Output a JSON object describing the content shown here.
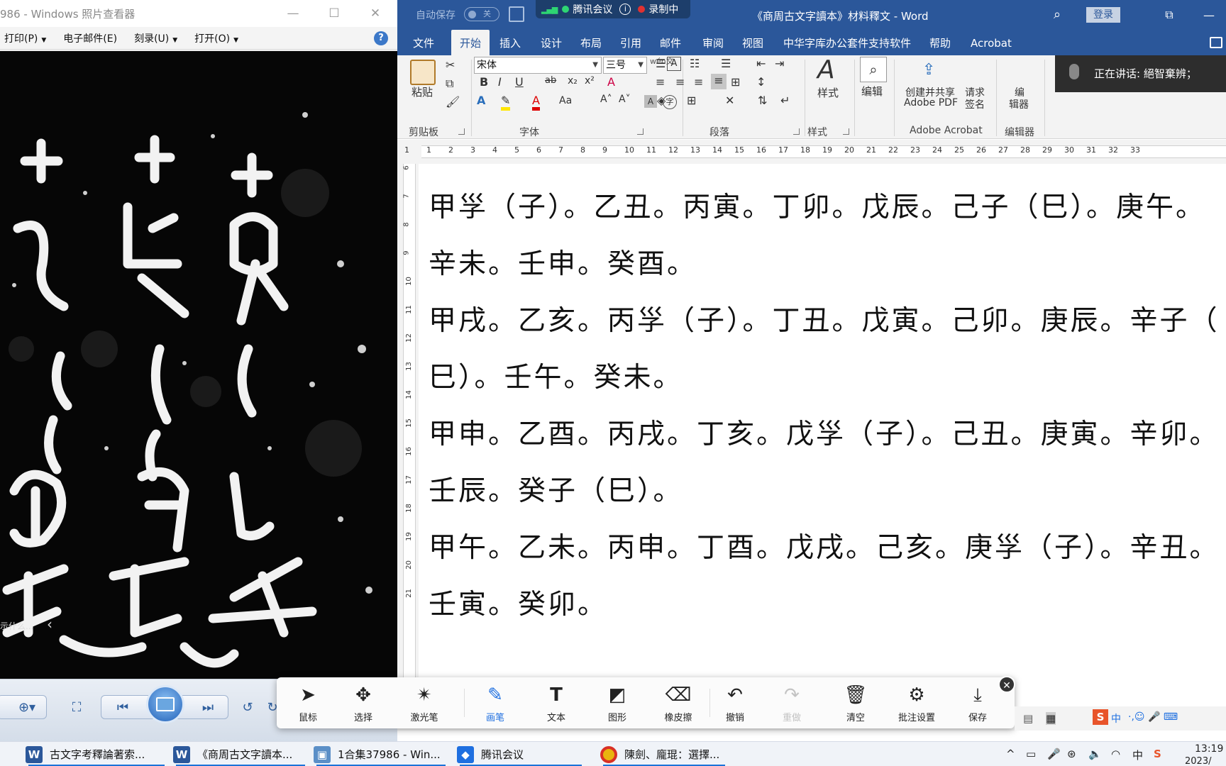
{
  "viewer": {
    "title": "986 - Windows 照片查看器",
    "menu": [
      "打印(P)",
      "电子邮件(E)",
      "刻录(U)",
      "打开(O)"
    ],
    "side_hint": "示什么..."
  },
  "word": {
    "autosave_label": "自动保存",
    "autosave_state": "关",
    "title": "《商周古文字讀本》材料釋文 - Word",
    "login_label": "登录",
    "tabs": [
      "文件",
      "开始",
      "插入",
      "设计",
      "布局",
      "引用",
      "邮件",
      "审阅",
      "视图",
      "中华字库办公套件支持软件",
      "帮助",
      "Acrobat"
    ],
    "ribbon": {
      "paste": "粘贴",
      "font_name": "宋体",
      "font_size": "三号",
      "phonetic": "wén文",
      "styles": "样式",
      "editing": "编辑",
      "create_pdf_1": "创建并共享",
      "create_pdf_2": "Adobe PDF",
      "request_sign_1": "请求",
      "request_sign_2": "签名",
      "editor_1": "编",
      "editor_2": "辑器",
      "groups": [
        "剪贴板",
        "字体",
        "段落",
        "样式",
        "Adobe Acrobat",
        "编辑器"
      ]
    },
    "ruler_h": [
      "1",
      "1",
      "2",
      "3",
      "4",
      "5",
      "6",
      "7",
      "8",
      "9",
      "10",
      "11",
      "12",
      "13",
      "14",
      "15",
      "16",
      "17",
      "18",
      "19",
      "20",
      "21",
      "22",
      "23",
      "24",
      "25",
      "26",
      "27",
      "28",
      "29",
      "30",
      "31",
      "32",
      "33"
    ],
    "ruler_v": [
      "6",
      "7",
      "8",
      "9",
      "10",
      "11",
      "12",
      "13",
      "14",
      "15",
      "16",
      "17",
      "18",
      "19",
      "20",
      "21"
    ],
    "paragraphs": [
      "甲㜽（子）。乙丑。丙寅。丁卯。戊辰。己子（巳）。庚午。",
      "辛未。壬申。癸酉。",
      "甲戌。乙亥。丙㜽（子）。丁丑。戊寅。己卯。庚辰。辛子（",
      "巳）。壬午。癸未。",
      "甲申。乙酉。丙戌。丁亥。戊㜽（子）。己丑。庚寅。辛卯。",
      "壬辰。癸子（巳）。",
      "甲午。乙未。丙申。丁酉。戊戌。己亥。庚㜽（子）。辛丑。",
      "壬寅。癸卯。"
    ]
  },
  "meeting": {
    "name": "腾讯会议",
    "recording": "录制中",
    "speaking": "正在讲话: 絕智棄辨；"
  },
  "annotation": {
    "tools": [
      "鼠标",
      "选择",
      "激光笔",
      "画笔",
      "文本",
      "图形",
      "橡皮擦",
      "撤销",
      "重做",
      "清空",
      "批注设置",
      "保存"
    ]
  },
  "taskbar": {
    "items": [
      "古文字考釋論著索...",
      "《商周古文字讀本...",
      "1合集37986 - Win...",
      "腾讯会议",
      "陳劍、龐琨：選擇..."
    ],
    "ime_mode": "中",
    "ime_tray": "中",
    "time": "13:19",
    "date": "2023/"
  },
  "colors": {
    "word_blue": "#2b579a",
    "active_tool": "#1e6fe0",
    "recording_red": "#e03131",
    "meeting_green": "#2ed573"
  }
}
